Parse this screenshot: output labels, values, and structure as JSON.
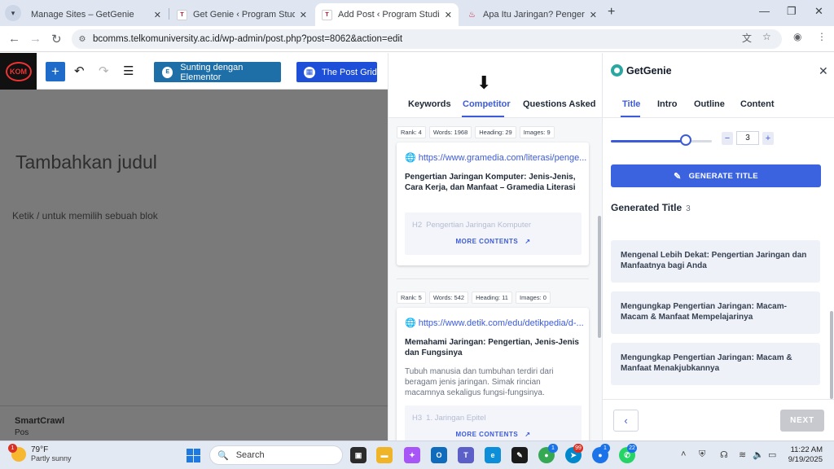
{
  "browser": {
    "tabs": [
      {
        "title": "Manage Sites – GetGenie",
        "favicon": "getgenie-icon",
        "active": false
      },
      {
        "title": "Get Genie ‹ Program Studi Ilmu K",
        "favicon": "telkom-icon",
        "active": false
      },
      {
        "title": "Add Post ‹ Program Studi Ilmu K",
        "favicon": "telkom-icon",
        "active": true
      },
      {
        "title": "Apa Itu Jaringan? Pengertian, Je",
        "favicon": "news-icon",
        "active": false
      }
    ],
    "url": "bcomms.telkomuniversity.ac.id/wp-admin/post.php?post=8062&action=edit"
  },
  "wp_toolbar": {
    "elementor_label": "Sunting dengan Elementor",
    "postgrid_label": "The Post Grid"
  },
  "editor": {
    "title_placeholder": "Tambahkan judul",
    "block_hint": "Ketik / untuk memilih sebuah blok",
    "meta_title": "SmartCrawl",
    "meta_sub": "Pos"
  },
  "competitor_panel": {
    "tabs": [
      "Keywords",
      "Competitor",
      "Questions Asked"
    ],
    "active_tab": "Competitor",
    "results": [
      {
        "stats": [
          "Rank: 4",
          "Words: 1968",
          "Heading: 29",
          "Images: 9"
        ],
        "url": "https://www.gramedia.com/literasi/penge...",
        "title": "Pengertian Jaringan Komputer: Jenis-Jenis, Cara Kerja, dan Manfaat – Gramedia Literasi",
        "description": "",
        "heading_tag": "H2",
        "heading_text": "Pengertian Jaringan Komputer",
        "more_label": "MORE CONTENTS"
      },
      {
        "stats": [
          "Rank: 5",
          "Words: 542",
          "Heading: 11",
          "Images: 0"
        ],
        "url": "https://www.detik.com/edu/detikpedia/d-...",
        "title": "Memahami Jaringan: Pengertian, Jenis-Jenis dan Fungsinya",
        "description": "Tubuh manusia dan tumbuhan terdiri dari beragam jenis jaringan. Simak rincian macamnya sekaligus fungsi-fungsinya.",
        "heading_tag": "H3",
        "heading_text": "1. Jaringan Epitel",
        "more_label": "MORE CONTENTS"
      }
    ]
  },
  "genie_panel": {
    "brand": "GetGenie",
    "tabs": [
      "Title",
      "Intro",
      "Outline",
      "Content"
    ],
    "active_tab": "Title",
    "slider_level": 0.74,
    "count_value": "3",
    "generate_label": "GENERATE TITLE",
    "generated_heading": "Generated Title",
    "generated_count": "3",
    "titles": [
      "Mengenal Lebih Dekat: Pengertian Jaringan dan Manfaatnya bagi Anda",
      "Mengungkap Pengertian Jaringan: Macam-Macam & Manfaat Mempelajarinya",
      "Mengungkap Pengertian Jaringan: Macam & Manfaat Menakjubkannya"
    ],
    "next_label": "NEXT"
  },
  "taskbar": {
    "temperature": "79°F",
    "weather": "Partly sunny",
    "weather_badge": "1",
    "search_placeholder": "Search",
    "chrome_badge": "1",
    "app_badge_red": "99",
    "app_badge_blue": "1",
    "whatsapp_badge": "22",
    "time": "11:22 AM",
    "date": "9/19/2025"
  }
}
